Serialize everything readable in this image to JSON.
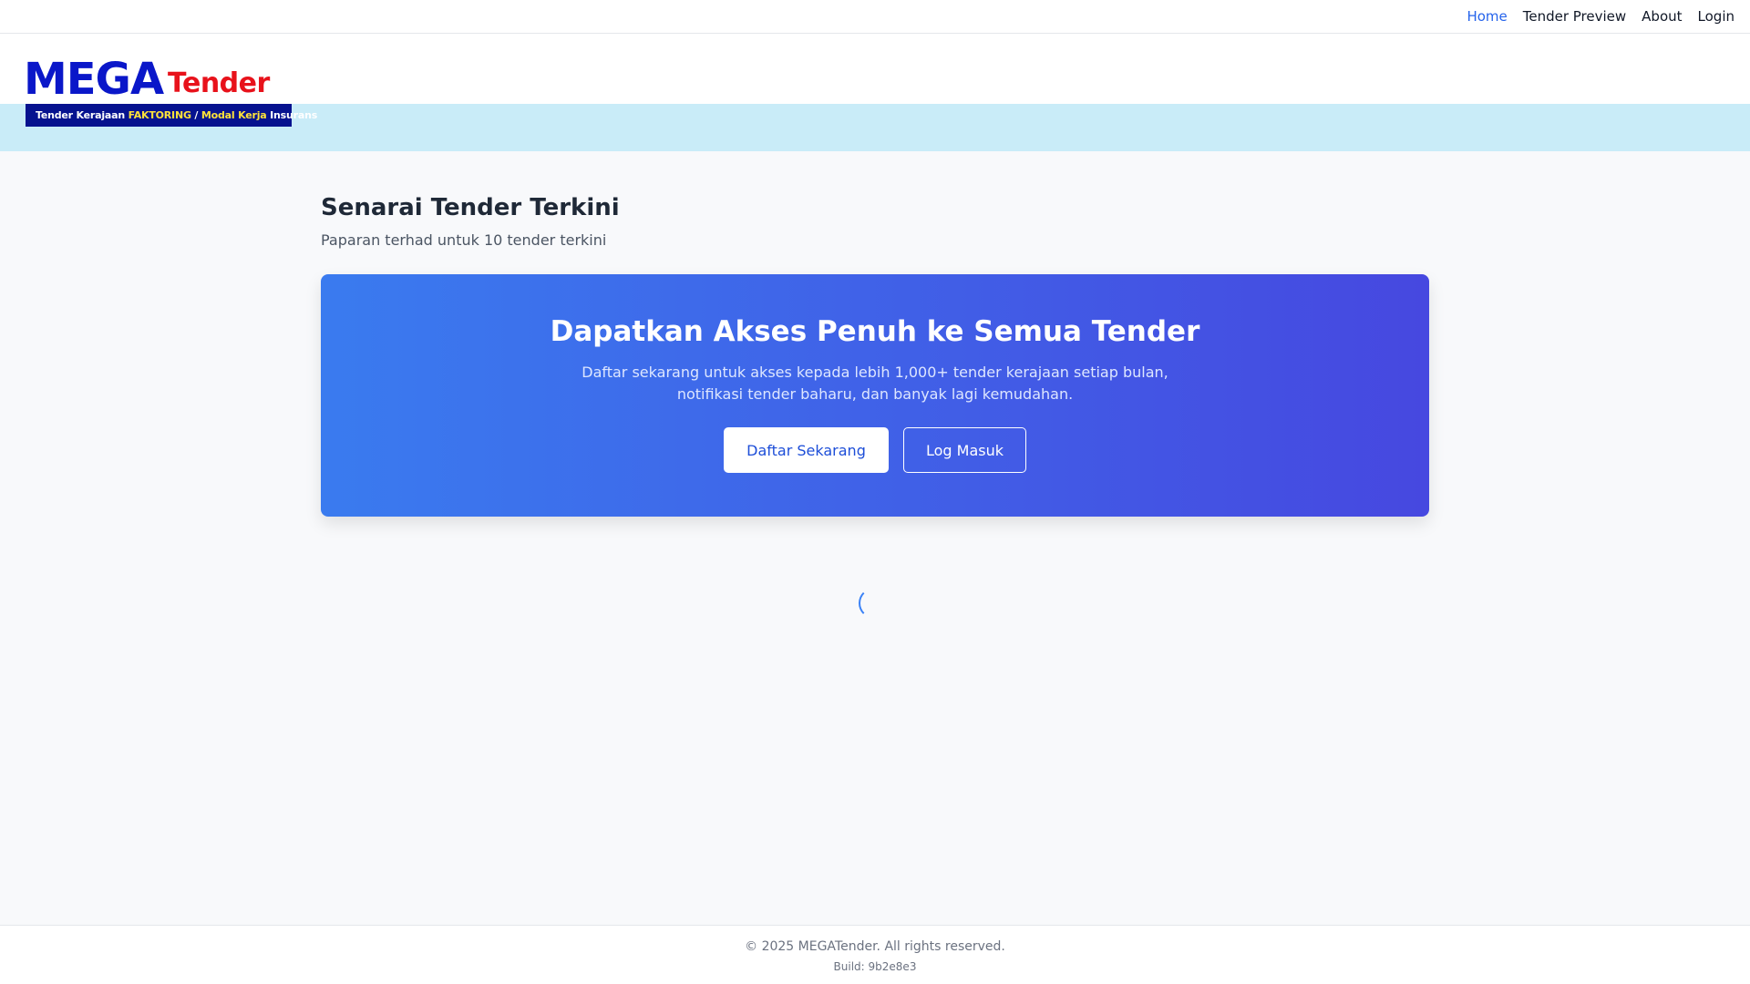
{
  "nav": {
    "items": [
      {
        "label": "Home",
        "active": true
      },
      {
        "label": "Tender Preview",
        "active": false
      },
      {
        "label": "About",
        "active": false
      },
      {
        "label": "Login",
        "active": false
      }
    ]
  },
  "logo": {
    "mega": "MEGA",
    "tender": "Tender",
    "tagline_prefix": "Tender Kerajaan ",
    "tagline_factoring": "FAKTORING",
    "tagline_sep": " / ",
    "tagline_modal": "Modal Kerja",
    "tagline_suffix": " Insurans"
  },
  "main": {
    "title": "Senarai Tender Terkini",
    "subtitle": "Paparan terhad untuk 10 tender terkini"
  },
  "cta": {
    "title": "Dapatkan Akses Penuh ke Semua Tender",
    "description": "Daftar sekarang untuk akses kepada lebih 1,000+ tender kerajaan setiap bulan, notifikasi tender baharu, dan banyak lagi kemudahan.",
    "register_label": "Daftar Sekarang",
    "login_label": "Log Masuk"
  },
  "footer": {
    "copyright": "© 2025 MEGATender. All rights reserved.",
    "build": "Build: 9b2e8e3"
  },
  "colors": {
    "accent": "#2563eb",
    "brand_blue": "#0a17c9",
    "brand_red": "#e8121b",
    "band": "#c9ecf8",
    "cta_start": "#3a7bef",
    "cta_end": "#4648e0"
  }
}
